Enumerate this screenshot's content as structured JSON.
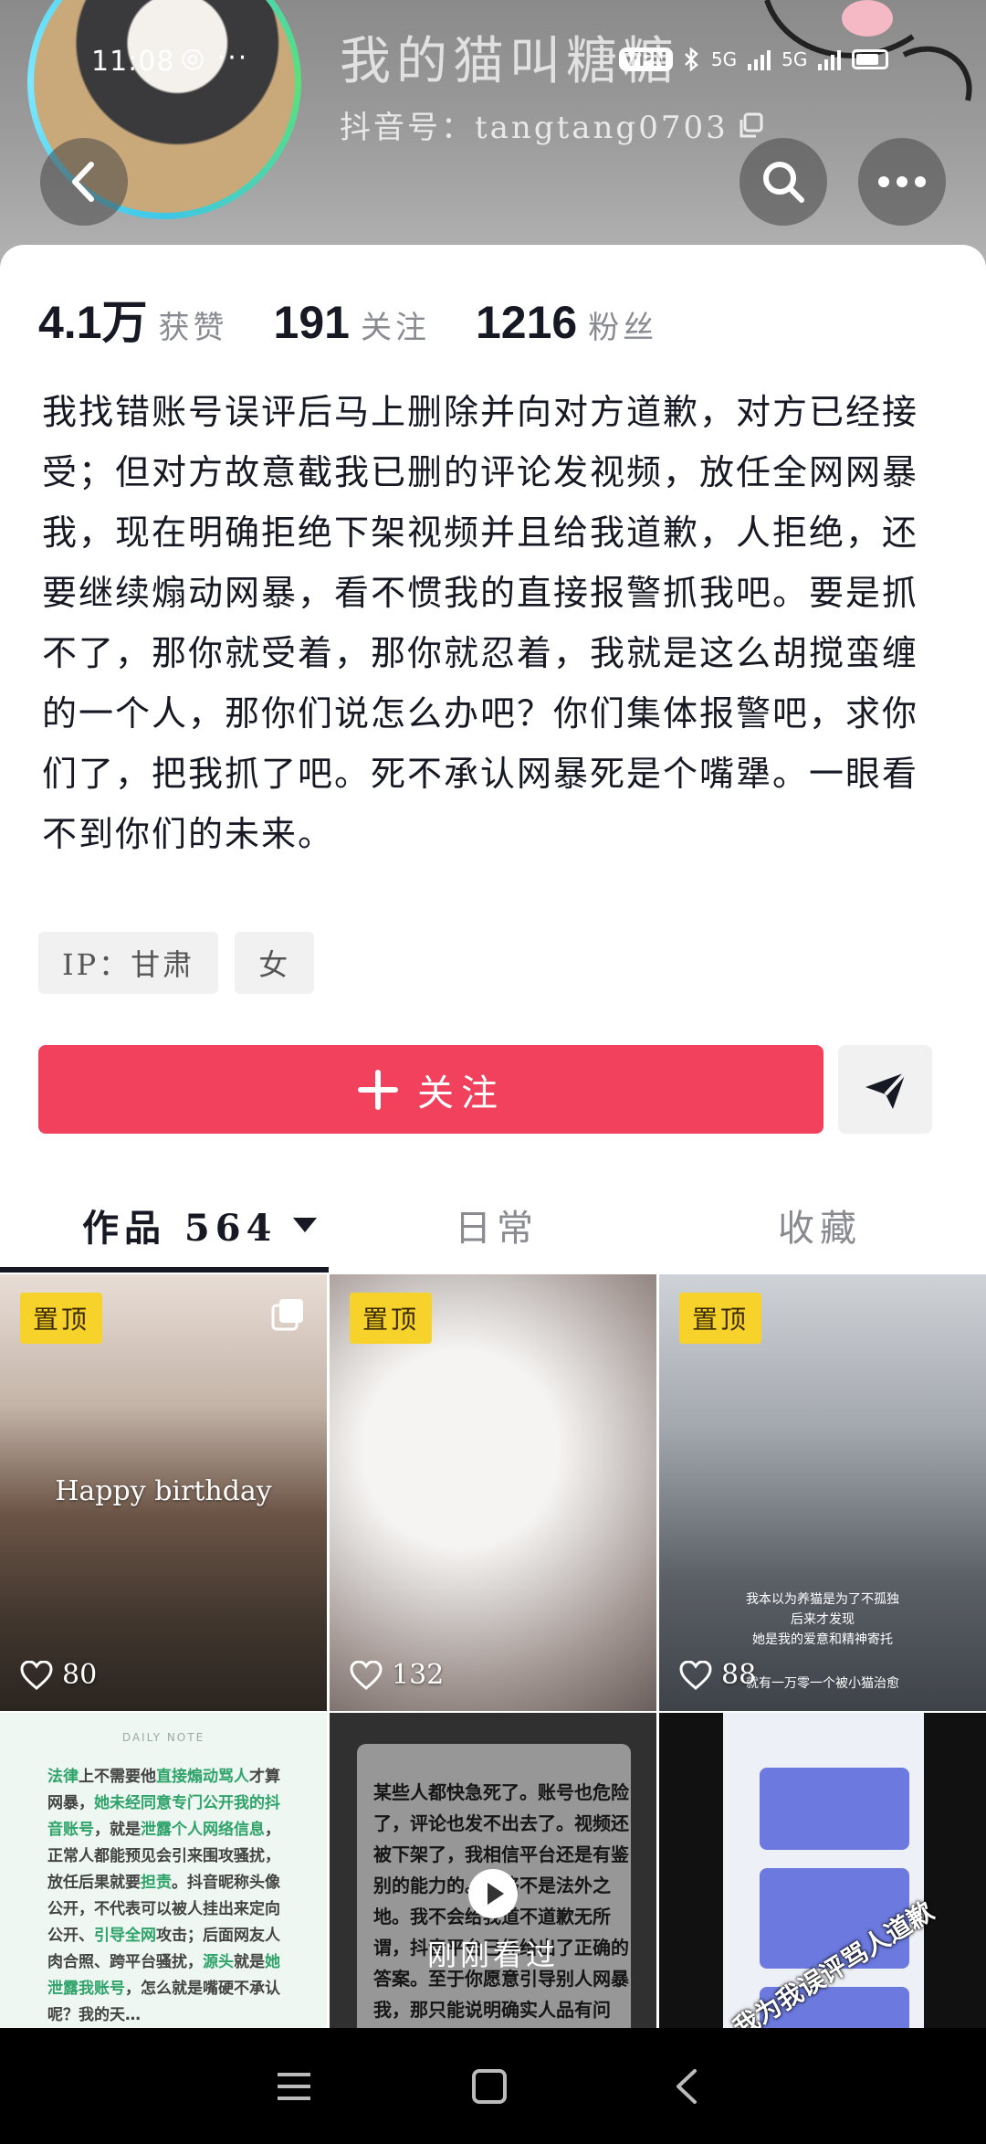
{
  "status_bar": {
    "time": "11:08",
    "dots": "◎ ···",
    "vpn": "VPN",
    "network_1": "5G",
    "network_2": "5G"
  },
  "profile": {
    "nickname": "我的猫叫糖糖",
    "douyin_id": "抖音号：tangtang0703"
  },
  "stats": [
    {
      "value": "4.1万",
      "label": "获赞"
    },
    {
      "value": "191",
      "label": "关注"
    },
    {
      "value": "1216",
      "label": "粉丝"
    }
  ],
  "bio": "我找错账号误评后马上删除并向对方道歉，对方已经接受；但对方故意截我已删的评论发视频，放任全网网暴我，现在明确拒绝下架视频并且给我道歉，人拒绝，还要继续煽动网暴，看不惯我的直接报警抓我吧。要是抓不了，那你就受着，那你就忍着，我就是这么胡搅蛮缠的一个人，那你们说怎么办吧？你们集体报警吧，求你们了，把我抓了吧。死不承认网暴死是个嘴犟。一眼看不到你们的未来。",
  "tags": [
    "IP：甘肃",
    "女"
  ],
  "follow_label": "关注",
  "tabs": {
    "works": "作品 564",
    "daily": "日常",
    "favorites": "收藏"
  },
  "videos": [
    {
      "pin": "置顶",
      "likes": "80",
      "caption": "Happy birthday"
    },
    {
      "pin": "置顶",
      "likes": "132"
    },
    {
      "pin": "置顶",
      "likes": "88",
      "subtitle_lines": [
        "我本以为养猫是为了不孤独",
        "后来才发现",
        "她是我的爱意和精神寄托",
        "就有一万零一个被小猫治愈"
      ]
    },
    {
      "header": "DAILY NOTE",
      "text_parts": [
        {
          "t": "法律",
          "g": true
        },
        {
          "t": "上不需要他",
          "g": false
        },
        {
          "t": "直接煽动骂人",
          "g": true
        },
        {
          "t": "才算网暴，",
          "g": false
        },
        {
          "t": "她未经同意专门公开我的抖音账号",
          "g": true
        },
        {
          "t": "，就是",
          "g": false
        },
        {
          "t": "泄露个人网络信息",
          "g": true
        },
        {
          "t": "，正常人都能预见会引来围攻骚扰，放任后果就要",
          "g": false
        },
        {
          "t": "担责",
          "g": true
        },
        {
          "t": "。抖音昵称头像公开，不代表可以被人挂出来定向公开、",
          "g": false
        },
        {
          "t": "引导全网",
          "g": true
        },
        {
          "t": "攻击；后面网友人肉合照、跨平台骚扰，",
          "g": false
        },
        {
          "t": "源头",
          "g": true
        },
        {
          "t": "就是",
          "g": false
        },
        {
          "t": "她泄露我账号",
          "g": true
        },
        {
          "t": "，怎么就是嘴硬不承认呢？我的天…",
          "g": false
        }
      ]
    },
    {
      "text": "某些人都快急死了。账号也危险了，评论也发不出去了。视频还被下架了，我相信平台还是有鉴别的能力的。网络不是法外之地。我不会给我道不道歉无所谓，抖音平台已经给出了正确的答案。至于你愿意引导别人网暴我，那只能说明确实人品有问题。",
      "watched_label": "刚刚看过"
    },
    {
      "caption": "我为我误评骂人道歉"
    }
  ]
}
